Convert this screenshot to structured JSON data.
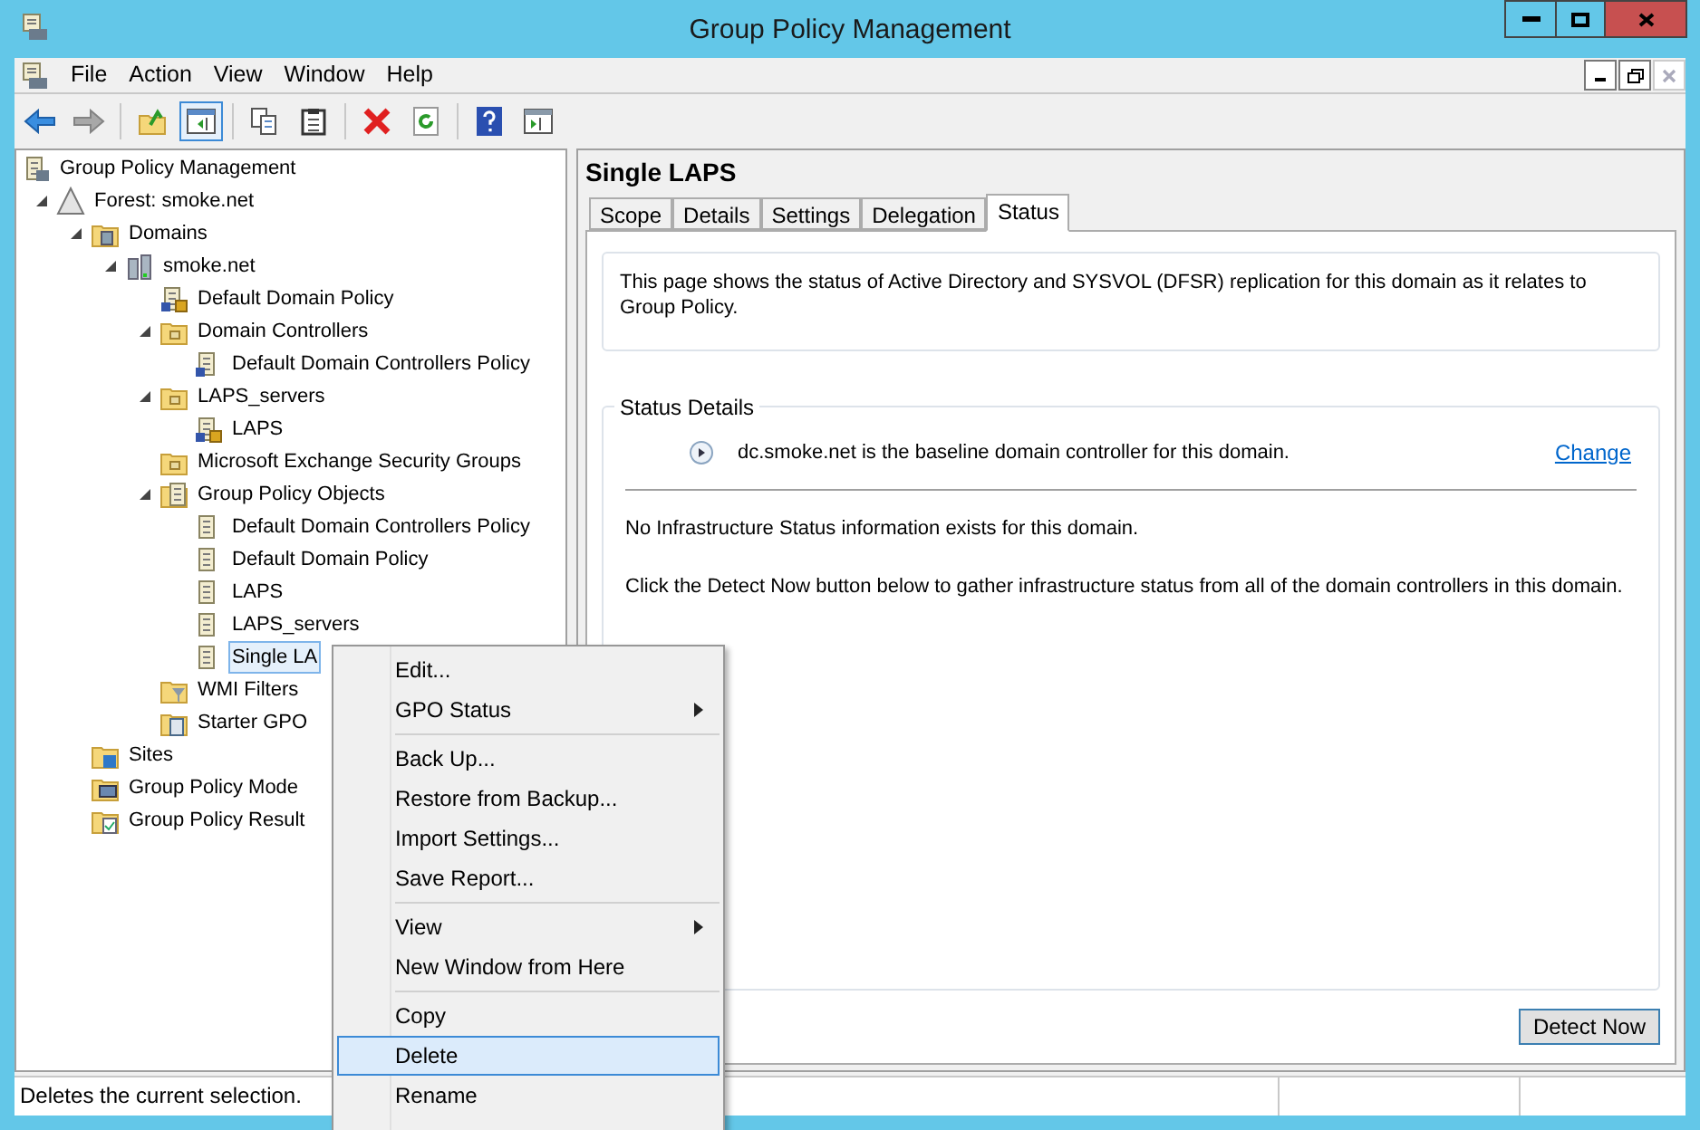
{
  "window": {
    "title": "Group Policy Management"
  },
  "menu_bar": [
    "File",
    "Action",
    "View",
    "Window",
    "Help"
  ],
  "toolbar": [
    {
      "kind": "back",
      "pressed": false,
      "disabled": false
    },
    {
      "kind": "forward",
      "pressed": false,
      "disabled": true
    },
    {
      "kind": "up",
      "pressed": false,
      "disabled": false
    },
    {
      "kind": "tree-toggle",
      "pressed": true,
      "disabled": false
    },
    {
      "kind": "copy",
      "pressed": false,
      "disabled": false
    },
    {
      "kind": "paste",
      "pressed": false,
      "disabled": false
    },
    {
      "kind": "delete",
      "pressed": false,
      "disabled": false
    },
    {
      "kind": "refresh",
      "pressed": false,
      "disabled": false
    },
    {
      "kind": "help",
      "pressed": false,
      "disabled": false
    },
    {
      "kind": "action-pane",
      "pressed": false,
      "disabled": false
    }
  ],
  "tree": [
    {
      "label": "Group Policy Management",
      "kind": "console",
      "selected": false,
      "children": [
        {
          "label": "Forest: smoke.net",
          "kind": "forest",
          "selected": false,
          "expanded": true,
          "children": [
            {
              "label": "Domains",
              "kind": "domains",
              "selected": false,
              "expanded": true,
              "children": [
                {
                  "label": "smoke.net",
                  "kind": "domain",
                  "selected": false,
                  "expanded": true,
                  "children": [
                    {
                      "label": "Default Domain Policy",
                      "kind": "link",
                      "enforced": true,
                      "selected": false
                    },
                    {
                      "label": "Domain Controllers",
                      "kind": "ou",
                      "selected": false,
                      "expanded": true,
                      "children": [
                        {
                          "label": "Default Domain Controllers Policy",
                          "kind": "link",
                          "enforced": false,
                          "selected": false
                        }
                      ]
                    },
                    {
                      "label": "LAPS_servers",
                      "kind": "ou",
                      "selected": false,
                      "expanded": true,
                      "children": [
                        {
                          "label": "LAPS",
                          "kind": "link",
                          "enforced": true,
                          "selected": false
                        }
                      ]
                    },
                    {
                      "label": "Microsoft Exchange Security Groups",
                      "kind": "ou",
                      "selected": false
                    },
                    {
                      "label": "Group Policy Objects",
                      "kind": "gpo-folder",
                      "selected": false,
                      "expanded": true,
                      "children": [
                        {
                          "label": "Default Domain Controllers Policy",
                          "kind": "gpo",
                          "selected": false
                        },
                        {
                          "label": "Default Domain Policy",
                          "kind": "gpo",
                          "selected": false
                        },
                        {
                          "label": "LAPS",
                          "kind": "gpo",
                          "selected": false
                        },
                        {
                          "label": "LAPS_servers",
                          "kind": "gpo",
                          "selected": false
                        },
                        {
                          "label": "Single LA",
                          "kind": "gpo",
                          "selected": true
                        }
                      ]
                    },
                    {
                      "label": "WMI Filters",
                      "kind": "wmi",
                      "selected": false
                    },
                    {
                      "label": "Starter GPO",
                      "kind": "starter",
                      "selected": false
                    }
                  ]
                }
              ]
            },
            {
              "label": "Sites",
              "kind": "sites",
              "selected": false
            },
            {
              "label": "Group Policy Mode",
              "kind": "modeling",
              "selected": false
            },
            {
              "label": "Group Policy Result",
              "kind": "results",
              "selected": false
            }
          ]
        }
      ]
    }
  ],
  "details": {
    "title": "Single LAPS",
    "tabs": [
      {
        "label": "Scope",
        "selected": false
      },
      {
        "label": "Details",
        "selected": false
      },
      {
        "label": "Settings",
        "selected": false
      },
      {
        "label": "Delegation",
        "selected": false
      },
      {
        "label": "Status",
        "selected": true
      }
    ],
    "intro": "This page shows the status of Active Directory and SYSVOL (DFSR) replication for this domain as it relates to Group Policy.",
    "status_details": {
      "legend": "Status Details",
      "baseline": "dc.smoke.net is the baseline domain controller for this domain.",
      "change_link": "Change",
      "no_info": "No Infrastructure Status information exists for this domain.",
      "instruction": "Click the Detect Now button below to gather infrastructure status from all of the domain controllers in this domain."
    },
    "detect_button": "Detect Now"
  },
  "context_menu": [
    {
      "kind": "item",
      "label": "Edit...",
      "submenu": false,
      "selected": false
    },
    {
      "kind": "item",
      "label": "GPO Status",
      "submenu": true,
      "selected": false
    },
    {
      "kind": "separator"
    },
    {
      "kind": "item",
      "label": "Back Up...",
      "submenu": false,
      "selected": false
    },
    {
      "kind": "item",
      "label": "Restore from Backup...",
      "submenu": false,
      "selected": false
    },
    {
      "kind": "item",
      "label": "Import Settings...",
      "submenu": false,
      "selected": false
    },
    {
      "kind": "item",
      "label": "Save Report...",
      "submenu": false,
      "selected": false
    },
    {
      "kind": "separator"
    },
    {
      "kind": "item",
      "label": "View",
      "submenu": true,
      "selected": false
    },
    {
      "kind": "item",
      "label": "New Window from Here",
      "submenu": false,
      "selected": false
    },
    {
      "kind": "separator"
    },
    {
      "kind": "item",
      "label": "Copy",
      "submenu": false,
      "selected": false
    },
    {
      "kind": "item",
      "label": "Delete",
      "submenu": false,
      "selected": true
    },
    {
      "kind": "item",
      "label": "Rename",
      "submenu": false,
      "selected": false
    }
  ],
  "status_bar": "Deletes the current selection."
}
